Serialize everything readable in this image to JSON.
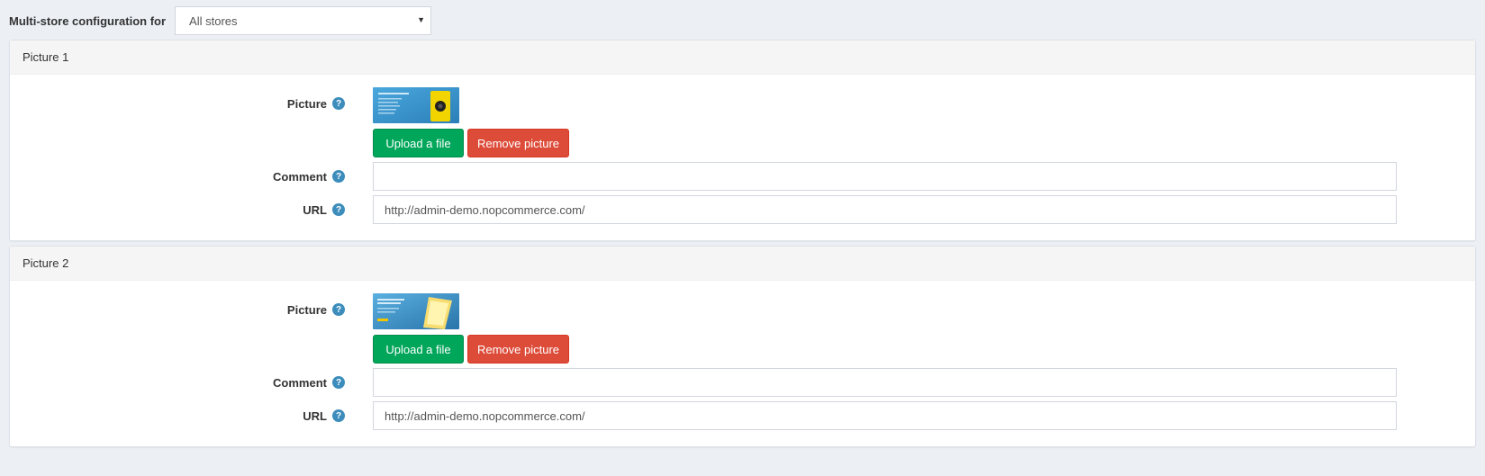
{
  "store_config": {
    "label": "Multi-store configuration for",
    "selected": "All stores"
  },
  "pictures": [
    {
      "title": "Picture 1",
      "picture_label": "Picture",
      "upload_label": "Upload a file",
      "remove_label": "Remove picture",
      "comment_label": "Comment",
      "comment_value": "",
      "url_label": "URL",
      "url_value": "http://admin-demo.nopcommerce.com/"
    },
    {
      "title": "Picture 2",
      "picture_label": "Picture",
      "upload_label": "Upload a file",
      "remove_label": "Remove picture",
      "comment_label": "Comment",
      "comment_value": "",
      "url_label": "URL",
      "url_value": "http://admin-demo.nopcommerce.com/"
    }
  ],
  "help_glyph": "?",
  "colors": {
    "upload": "#00a65a",
    "remove": "#dd4b39",
    "help": "#3c8dbc"
  }
}
